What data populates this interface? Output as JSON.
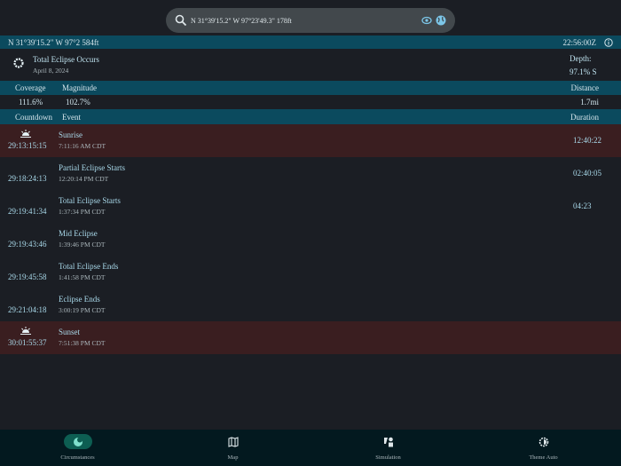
{
  "search": {
    "value": "N 31°39'15.2\" W 97°23'49.3\"  178ft"
  },
  "location_bar": {
    "coords": "N 31°39'15.2\" W 97°2 584ft",
    "time": "22:56:00Z"
  },
  "summary": {
    "title": "Total Eclipse Occurs",
    "date": "April 8, 2024",
    "depth_label": "Depth:",
    "depth_value": "97.1% S"
  },
  "stats_header": {
    "coverage": "Coverage",
    "magnitude": "Magnitude",
    "distance": "Distance"
  },
  "stats": {
    "coverage": "111.6%",
    "magnitude": "102.7%",
    "distance": "1.7mi"
  },
  "events_header": {
    "countdown": "Countdown",
    "event": "Event",
    "duration": "Duration"
  },
  "events": [
    {
      "countdown": "29:13:15:15",
      "name": "Sunrise",
      "time": "7:11:16 AM CDT",
      "duration": "12:40:22"
    },
    {
      "countdown": "29:18:24:13",
      "name": "Partial Eclipse Starts",
      "time": "12:20:14 PM CDT",
      "duration": "02:40:05"
    },
    {
      "countdown": "29:19:41:34",
      "name": "Total Eclipse Starts",
      "time": "1:37:34 PM CDT",
      "duration": "04:23"
    },
    {
      "countdown": "29:19:43:46",
      "name": "Mid Eclipse",
      "time": "1:39:46 PM CDT",
      "duration": ""
    },
    {
      "countdown": "29:19:45:58",
      "name": "Total Eclipse Ends",
      "time": "1:41:58 PM CDT",
      "duration": ""
    },
    {
      "countdown": "29:21:04:18",
      "name": "Eclipse Ends",
      "time": "3:00:19 PM CDT",
      "duration": ""
    },
    {
      "countdown": "30:01:55:37",
      "name": "Sunset",
      "time": "7:51:38 PM CDT",
      "duration": ""
    }
  ],
  "nav": [
    {
      "label": "Circumstances"
    },
    {
      "label": "Map"
    },
    {
      "label": "Simulation"
    },
    {
      "label": "Theme Auto"
    }
  ]
}
